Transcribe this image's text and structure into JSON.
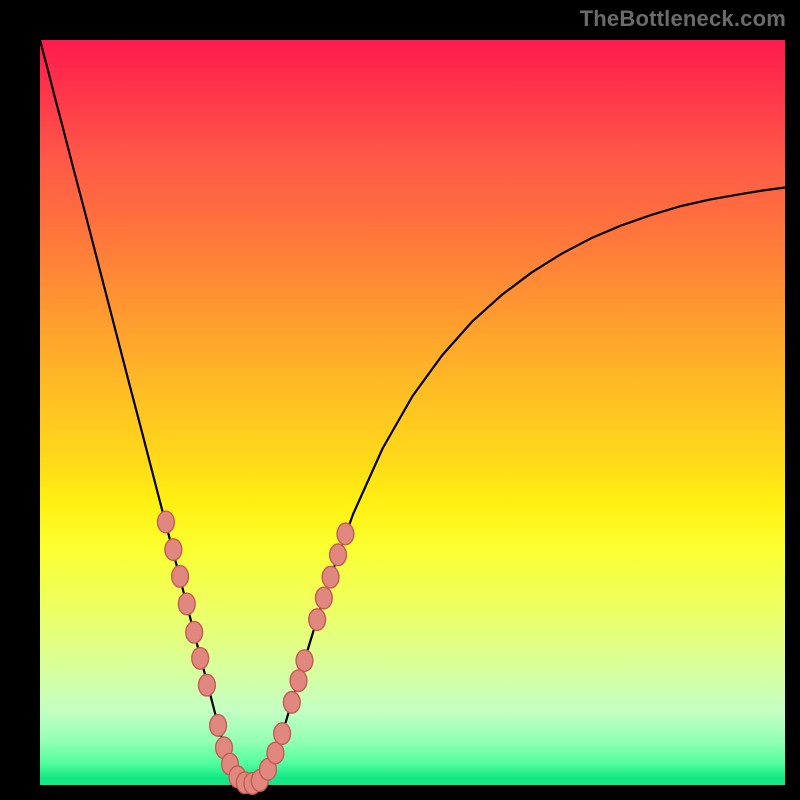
{
  "watermark": "TheBottleneck.com",
  "chart_data": {
    "type": "line",
    "title": "",
    "xlabel": "",
    "ylabel": "",
    "xlim": [
      0,
      1
    ],
    "ylim": [
      0,
      1
    ],
    "x": [
      0.0,
      0.01,
      0.02,
      0.03,
      0.045,
      0.06,
      0.075,
      0.09,
      0.105,
      0.12,
      0.135,
      0.15,
      0.165,
      0.18,
      0.195,
      0.21,
      0.225,
      0.24,
      0.254,
      0.262,
      0.27,
      0.277,
      0.282,
      0.287,
      0.3,
      0.315,
      0.33,
      0.345,
      0.365,
      0.385,
      0.42,
      0.46,
      0.5,
      0.54,
      0.58,
      0.62,
      0.66,
      0.7,
      0.74,
      0.78,
      0.82,
      0.86,
      0.9,
      0.94,
      0.97,
      1.0
    ],
    "values": [
      1.0,
      0.962,
      0.923,
      0.885,
      0.827,
      0.77,
      0.712,
      0.654,
      0.596,
      0.538,
      0.481,
      0.423,
      0.365,
      0.308,
      0.25,
      0.192,
      0.135,
      0.077,
      0.03,
      0.012,
      0.005,
      0.002,
      0.001,
      0.001,
      0.01,
      0.04,
      0.085,
      0.135,
      0.2,
      0.265,
      0.363,
      0.452,
      0.522,
      0.577,
      0.622,
      0.658,
      0.688,
      0.713,
      0.734,
      0.751,
      0.765,
      0.777,
      0.786,
      0.793,
      0.798,
      0.802
    ],
    "beads": [
      {
        "x": 0.169,
        "y": 0.353
      },
      {
        "x": 0.179,
        "y": 0.316
      },
      {
        "x": 0.188,
        "y": 0.28
      },
      {
        "x": 0.197,
        "y": 0.243
      },
      {
        "x": 0.207,
        "y": 0.205
      },
      {
        "x": 0.215,
        "y": 0.17
      },
      {
        "x": 0.224,
        "y": 0.134
      },
      {
        "x": 0.239,
        "y": 0.08
      },
      {
        "x": 0.247,
        "y": 0.05
      },
      {
        "x": 0.255,
        "y": 0.028
      },
      {
        "x": 0.265,
        "y": 0.011
      },
      {
        "x": 0.275,
        "y": 0.003
      },
      {
        "x": 0.285,
        "y": 0.002
      },
      {
        "x": 0.295,
        "y": 0.006
      },
      {
        "x": 0.306,
        "y": 0.021
      },
      {
        "x": 0.316,
        "y": 0.043
      },
      {
        "x": 0.325,
        "y": 0.069
      },
      {
        "x": 0.338,
        "y": 0.111
      },
      {
        "x": 0.347,
        "y": 0.14
      },
      {
        "x": 0.355,
        "y": 0.167
      },
      {
        "x": 0.372,
        "y": 0.222
      },
      {
        "x": 0.381,
        "y": 0.251
      },
      {
        "x": 0.39,
        "y": 0.279
      },
      {
        "x": 0.4,
        "y": 0.309
      },
      {
        "x": 0.41,
        "y": 0.337
      }
    ],
    "bead_radius_px": 8
  }
}
